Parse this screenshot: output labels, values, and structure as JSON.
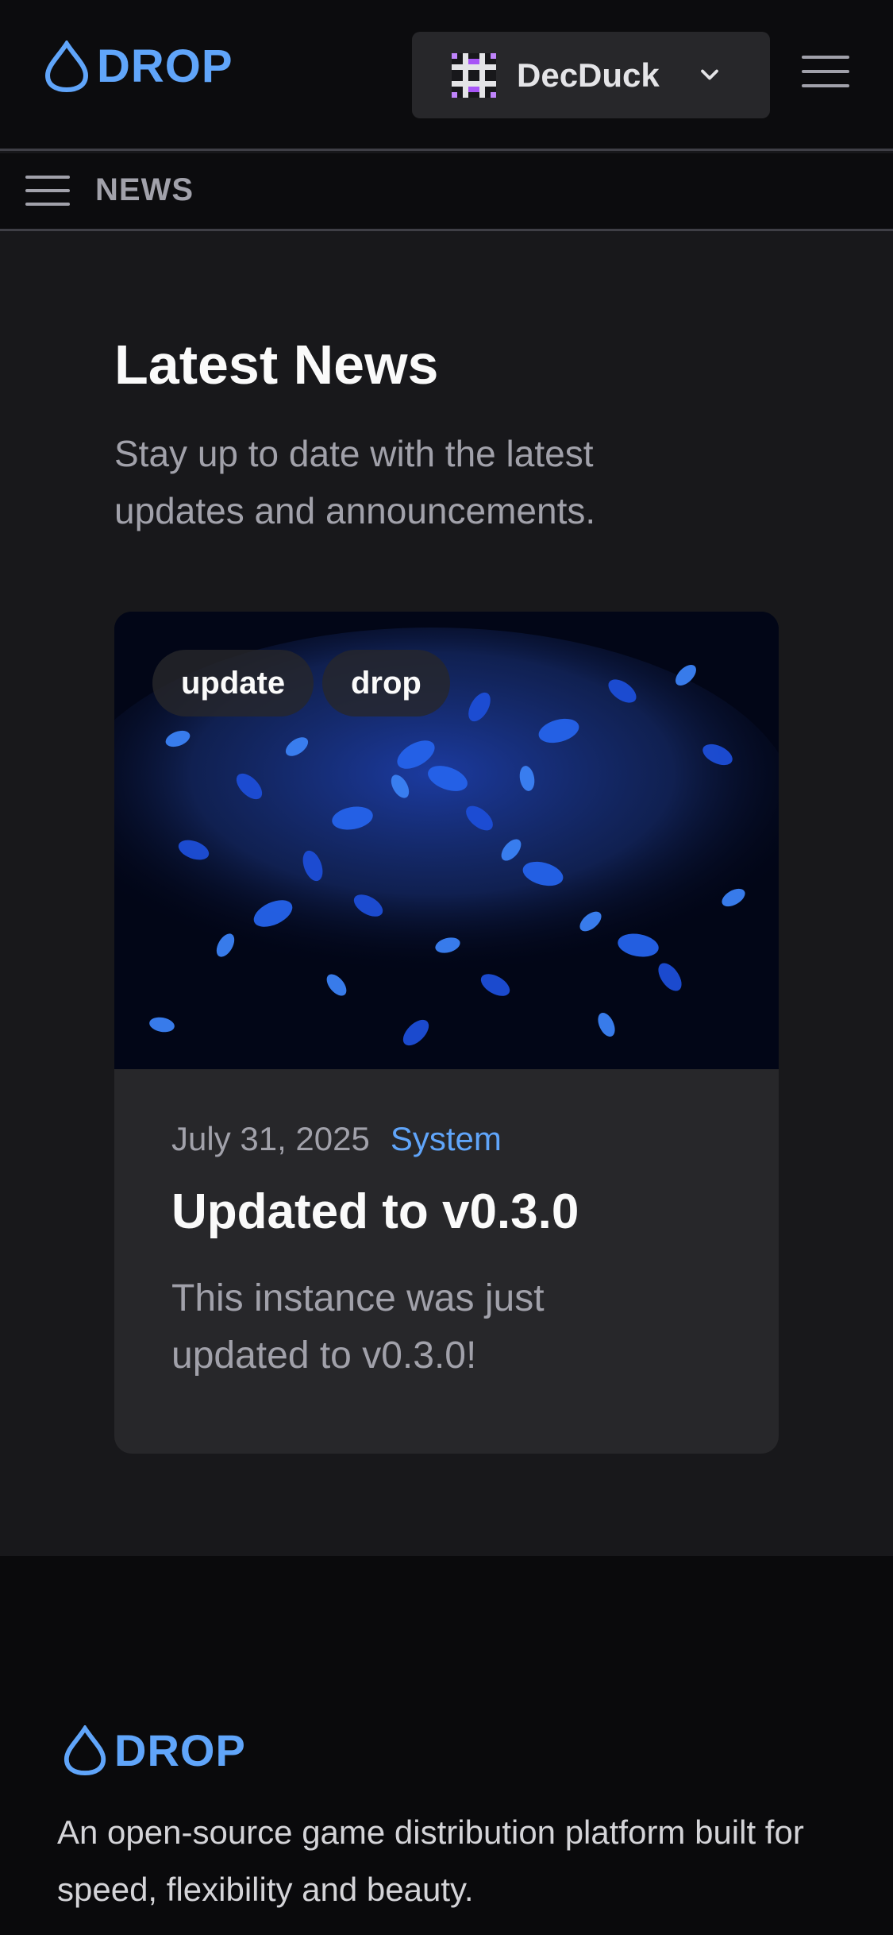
{
  "header": {
    "logo_text": "DROP",
    "user_name": "DecDuck",
    "icons": {
      "logo": "drop-icon",
      "user_avatar": "pixel-avatar",
      "dropdown": "chevron-down-icon",
      "menu": "hamburger-icon"
    }
  },
  "subnav": {
    "label": "NEWS",
    "icon": "hamburger-icon"
  },
  "main": {
    "title": "Latest News",
    "subtitle": "Stay up to date with the latest updates and announcements."
  },
  "articles": [
    {
      "tags": [
        "update",
        "drop"
      ],
      "date": "July 31, 2025",
      "category": "System",
      "title": "Updated to v0.3.0",
      "description": "This instance was just updated to v0.3.0!"
    }
  ],
  "footer": {
    "logo_text": "DROP",
    "description": "An open-source game distribution platform built for speed, flexibility and beauty."
  },
  "colors": {
    "accent": "#60a5fa",
    "background": "#18181b",
    "card": "#27272a",
    "topbar": "#0c0c0e"
  }
}
